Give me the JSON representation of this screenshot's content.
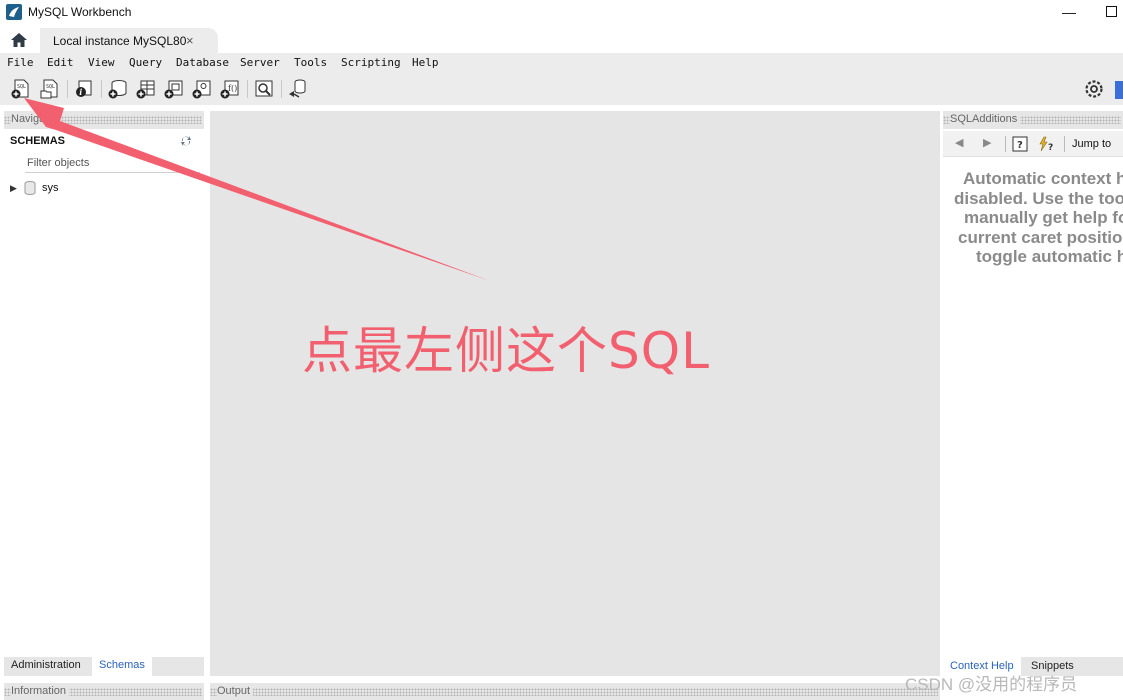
{
  "window": {
    "title": "MySQL Workbench"
  },
  "tabs": {
    "connection_tab_label": "Local instance MySQL80",
    "close_glyph": "×"
  },
  "menu": {
    "items": [
      "File",
      "Edit",
      "View",
      "Query",
      "Database",
      "Server",
      "Tools",
      "Scripting",
      "Help"
    ]
  },
  "navigator": {
    "header": "Navigator",
    "schemas_title": "SCHEMAS",
    "filter_placeholder": "Filter objects",
    "schemas": [
      {
        "name": "sys"
      }
    ],
    "bottom_tabs": [
      "Administration",
      "Schemas"
    ],
    "active_bottom_tab": "Schemas"
  },
  "information": {
    "header": "Information"
  },
  "output": {
    "header": "Output"
  },
  "sql_additions": {
    "header": "SQLAdditions",
    "jump_to_label": "Jump to",
    "help_lines": [
      "Automatic context help is",
      "disabled. Use the toolbar to",
      "manually get help for the",
      "current caret position or to",
      "toggle automatic help."
    ],
    "bottom_tabs": [
      "Context Help",
      "Snippets"
    ],
    "active_bottom_tab": "Context Help"
  },
  "annotation": {
    "text": "点最左侧这个SQL",
    "color": "#f25f6e"
  },
  "watermark": {
    "text": "CSDN @没用的程序员"
  },
  "colors": {
    "accent_blue": "#2b62b8",
    "annotation_red": "#f25f6e",
    "panel_bg": "#e5e5e5"
  }
}
